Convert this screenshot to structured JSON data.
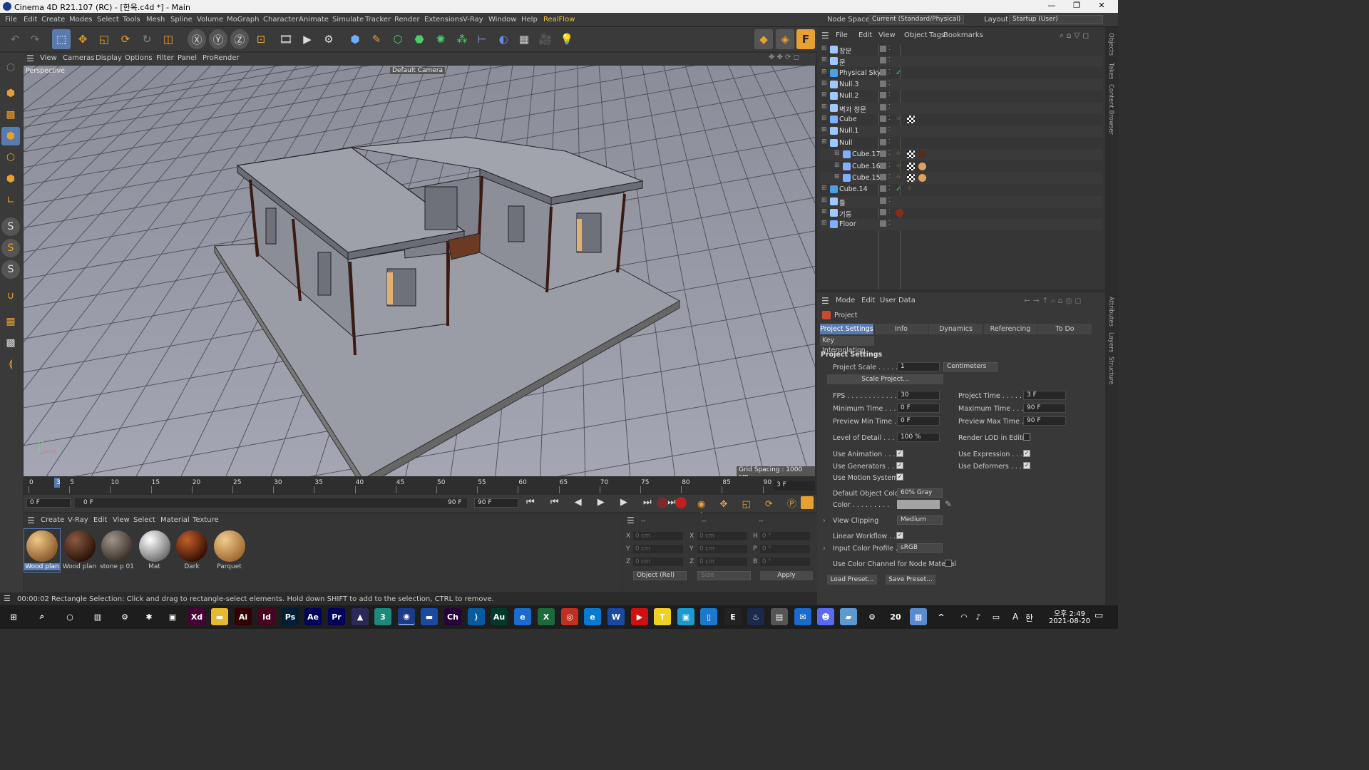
{
  "window": {
    "title": "Cinema 4D R21.107 (RC) - [한옥.c4d *] - Main",
    "min": "—",
    "max": "❐",
    "close": "✕"
  },
  "menu": [
    "File",
    "Edit",
    "Create",
    "Modes",
    "Select",
    "Tools",
    "Mesh",
    "Spline",
    "Volume",
    "MoGraph",
    "Character",
    "Animate",
    "Simulate",
    "Tracker",
    "Render",
    "Extensions",
    "V-Ray",
    "Window",
    "Help",
    "RealFlow"
  ],
  "nodespace": {
    "label": "Node Space:",
    "value": "Current (Standard/Physical)"
  },
  "layout": {
    "label": "Layout:",
    "value": "Startup (User)"
  },
  "viewport_menu": [
    "View",
    "Cameras",
    "Display",
    "Options",
    "Filter",
    "Panel",
    "ProRender"
  ],
  "viewport": {
    "name": "Perspective",
    "camera": "Default Camera",
    "grid_spacing": "Grid Spacing : 1000 cm",
    "axis_y": "Y",
    "axis_x": "X"
  },
  "objects_menu": [
    "File",
    "Edit",
    "View",
    "Object",
    "Tags",
    "Bookmarks"
  ],
  "objects": [
    {
      "name": "창문",
      "color": "#9ec8ff",
      "tags": []
    },
    {
      "name": "문",
      "color": "#9ec8ff",
      "tags": []
    },
    {
      "name": "Physical Sky",
      "color": "#4aa0e0",
      "tags": [
        "check"
      ]
    },
    {
      "name": "Null.3",
      "color": "#9ec8ff",
      "tags": []
    },
    {
      "name": "Null.2",
      "color": "#9ec8ff",
      "tags": []
    },
    {
      "name": "벽과 창문",
      "color": "#9ec8ff",
      "tags": []
    },
    {
      "name": "Cube",
      "color": "#7fb0ff",
      "tags": [
        "phong",
        "checker"
      ]
    },
    {
      "name": "Null.1",
      "color": "#9ec8ff",
      "tags": []
    },
    {
      "name": "Null",
      "color": "#9ec8ff",
      "tags": []
    },
    {
      "name": "Cube.17",
      "color": "#7fb0ff",
      "tags": [
        "phong",
        "checker",
        "wood"
      ]
    },
    {
      "name": "Cube.16",
      "color": "#7fb0ff",
      "tags": [
        "phong",
        "checker",
        "light"
      ]
    },
    {
      "name": "Cube.15",
      "color": "#7fb0ff",
      "tags": [
        "phong",
        "checker",
        "light"
      ]
    },
    {
      "name": "Cube.14",
      "color": "#4aa0e0",
      "tags": [
        "check",
        "phong"
      ]
    },
    {
      "name": "틀",
      "color": "#9ec8ff",
      "tags": []
    },
    {
      "name": "기둥",
      "color": "#9ec8ff",
      "tags": [
        "dark"
      ]
    },
    {
      "name": "Floor",
      "color": "#7fb0ff",
      "tags": []
    }
  ],
  "attr_menu": [
    "Mode",
    "Edit",
    "User Data"
  ],
  "attr": {
    "title": "Project",
    "tabs": [
      "Project Settings",
      "Info",
      "Dynamics",
      "Referencing",
      "To Do"
    ],
    "subtab": "Key Interpolation",
    "section": "Project Settings",
    "project_scale_label": "Project Scale . . . . .",
    "project_scale": "1",
    "scale_unit": "Centimeters",
    "scale_project": "Scale Project...",
    "fps_label": "FPS . . . . . . . . . . . . .",
    "fps": "30",
    "project_time_label": "Project Time . . . . . .",
    "project_time": "3 F",
    "min_time_label": "Minimum Time . . .",
    "min_time": "0 F",
    "max_time_label": "Maximum Time . . .",
    "max_time": "90 F",
    "prev_min_label": "Preview Min Time . .",
    "prev_min": "0 F",
    "prev_max_label": "Preview Max Time . .",
    "prev_max": "90 F",
    "lod_label": "Level of Detail . . . .",
    "lod": "100 %",
    "render_lod_label": "Render LOD in Editor",
    "use_anim_label": "Use Animation . . . .",
    "use_expr_label": "Use Expression . . . .",
    "use_gen_label": "Use Generators . . . .",
    "use_def_label": "Use Deformers . . . .",
    "use_motion_label": "Use Motion System",
    "def_obj_color_label": "Default Object Color",
    "def_obj_color": "60% Gray",
    "color_label": "Color . . . . . . . . .",
    "view_clip_label": "View Clipping",
    "view_clip": "Medium",
    "linear_label": "Linear Workflow . . .",
    "input_profile_label": "Input Color Profile . .",
    "input_profile": "sRGB",
    "color_channel_label": "Use Color Channel for Node Material",
    "load_preset": "Load Preset...",
    "save_preset": "Save Preset..."
  },
  "side_tabs": [
    "Objects",
    "Takes",
    "Content Browser",
    "Attributes",
    "Layers",
    "Structure"
  ],
  "timeline": {
    "ticks": [
      "0",
      "5",
      "10",
      "15",
      "20",
      "25",
      "30",
      "35",
      "40",
      "45",
      "50",
      "55",
      "60",
      "65",
      "70",
      "75",
      "80",
      "85",
      "90"
    ],
    "current_marker": "3",
    "frame_field": "3 F"
  },
  "transport": {
    "start": "0 F",
    "cur": "0 F",
    "end": "90 F",
    "end2": "90 F"
  },
  "mat_menu": [
    "Create",
    "V-Ray",
    "Edit",
    "View",
    "Select",
    "Material",
    "Texture"
  ],
  "materials": [
    {
      "name": "Wood plan",
      "c1": "#f0c88a",
      "c2": "#8a5a2a"
    },
    {
      "name": "Wood plan",
      "c1": "#8a5a40",
      "c2": "#2a1208"
    },
    {
      "name": "stone p 01",
      "c1": "#a0948a",
      "c2": "#3a302a"
    },
    {
      "name": "Mat",
      "c1": "#ffffff",
      "c2": "#707070"
    },
    {
      "name": "Dark",
      "c1": "#c0602a",
      "c2": "#3a0e04"
    },
    {
      "name": "Parquet",
      "c1": "#f2cc90",
      "c2": "#a06a30"
    }
  ],
  "coords": {
    "hdr1": "--",
    "hdr2": "--",
    "hdr3": "--",
    "x": "0 cm",
    "y": "0 cm",
    "z": "0 cm",
    "sx": "0 cm",
    "sy": "0 cm",
    "sz": "0 cm",
    "h": "0 °",
    "p": "0 °",
    "b": "0 °",
    "mode": "Object (Rel)",
    "size": "Size",
    "apply": "Apply"
  },
  "status": {
    "time": "00:00:02",
    "msg": "Rectangle Selection: Click and drag to rectangle-select elements. Hold down SHIFT to add to the selection, CTRL to remove."
  },
  "taskbar": {
    "clock": "오후 2:49",
    "date": "2021-08-20",
    "lang": "A",
    "ime": "한"
  }
}
